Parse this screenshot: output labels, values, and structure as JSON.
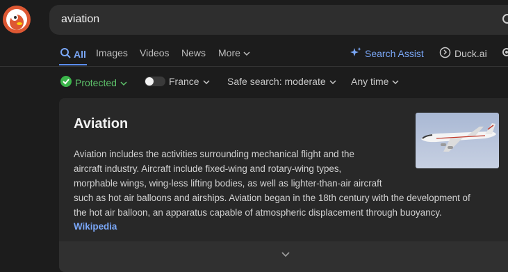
{
  "search": {
    "query": "aviation"
  },
  "tabs": [
    {
      "label": "All",
      "icon": "search-icon"
    },
    {
      "label": "Images"
    },
    {
      "label": "Videos"
    },
    {
      "label": "News"
    },
    {
      "label": "More",
      "icon": "chevron-down-icon"
    }
  ],
  "right_nav": {
    "search_assist": "Search Assist",
    "duck_ai": "Duck.ai"
  },
  "filters": {
    "protected": "Protected",
    "region": "France",
    "safe_search": "Safe search: moderate",
    "time": "Any time"
  },
  "card": {
    "title": "Aviation",
    "body_lines": [
      "Aviation includes the activities surrounding mechanical flight and the",
      "aircraft industry. Aircraft include fixed-wing and rotary-wing types,",
      "morphable wings, wing-less lifting bodies, as well as lighter-than-air aircraft",
      "such as hot air balloons and airships. Aviation began in the 18th century with the development of",
      "the hot air balloon, an apparatus capable of atmospheric displacement through buoyancy."
    ],
    "source_link": "Wikipedia"
  },
  "colors": {
    "background": "#1c1c1c",
    "accent": "#7aa7f7",
    "protected_green": "#3bb54a",
    "card": "#282828"
  }
}
